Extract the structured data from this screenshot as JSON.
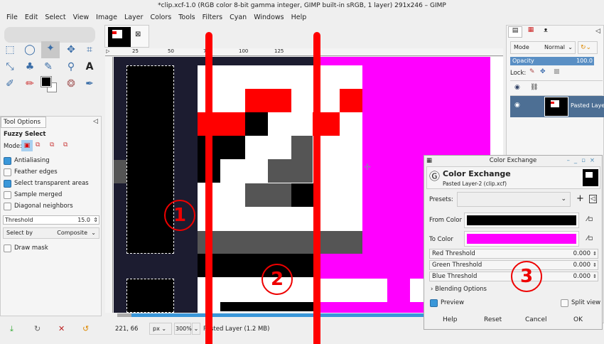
{
  "window": {
    "title": "*clip.xcf-1.0 (RGB color 8-bit gamma integer, GIMP built-in sRGB, 1 layer) 291x246 – GIMP"
  },
  "menu": [
    "File",
    "Edit",
    "Select",
    "View",
    "Image",
    "Layer",
    "Colors",
    "Tools",
    "Filters",
    "Cyan",
    "Windows",
    "Help"
  ],
  "ruler": {
    "ticks": [
      "25",
      "50",
      "75",
      "100",
      "125"
    ]
  },
  "tool_options": {
    "tab": "Tool Options",
    "tool": "Fuzzy Select",
    "mode_label": "Mode:",
    "options": [
      {
        "label": "Antialiasing",
        "checked": true
      },
      {
        "label": "Feather edges",
        "checked": false
      },
      {
        "label": "Select transparent areas",
        "checked": true
      },
      {
        "label": "Sample merged",
        "checked": false
      },
      {
        "label": "Diagonal neighbors",
        "checked": false
      }
    ],
    "threshold_label": "Threshold",
    "threshold_value": "15.0",
    "select_by_label": "Select by",
    "select_by_value": "Composite",
    "draw_mask": "Draw mask"
  },
  "status": {
    "coords": "221, 66",
    "unit": "px",
    "zoom": "300%",
    "layer_info": "Pasted Layer (1.2 MB)"
  },
  "layers": {
    "mode_label": "Mode",
    "mode_value": "Normal",
    "opacity_label": "Opacity",
    "opacity_value": "100.0",
    "lock_label": "Lock:",
    "layer_name": "Pasted Layer"
  },
  "dialog": {
    "window_title": "Color Exchange",
    "heading": "Color Exchange",
    "subtitle": "Pasted Layer-2 (clip.xcf)",
    "presets_label": "Presets:",
    "from_label": "From Color",
    "to_label": "To Color",
    "from_color": "#000000",
    "to_color": "#ff00ff",
    "thresholds": [
      {
        "label": "Red Threshold",
        "value": "0.000"
      },
      {
        "label": "Green Threshold",
        "value": "0.000"
      },
      {
        "label": "Blue Threshold",
        "value": "0.000"
      }
    ],
    "blending": "Blending Options",
    "preview": "Preview",
    "split_view": "Split view",
    "buttons": [
      "Help",
      "Reset",
      "Cancel",
      "OK"
    ]
  },
  "annotations": [
    "1",
    "2",
    "3"
  ]
}
